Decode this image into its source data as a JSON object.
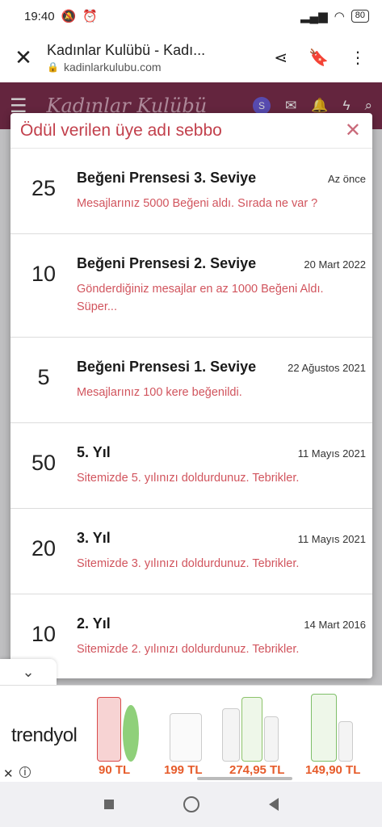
{
  "status_bar": {
    "time": "19:40",
    "battery": "80",
    "icons": [
      "mute-icon",
      "alarm-icon",
      "signal-icon",
      "wifi-icon"
    ]
  },
  "browser": {
    "title": "Kadınlar Kulübü - Kadı...",
    "url": "kadinlarkulubu.com",
    "icons": [
      "close-icon",
      "lock-icon",
      "share-icon",
      "bookmark-icon",
      "more-icon"
    ]
  },
  "site_header": {
    "logo": "Kadınlar Kulübü",
    "avatar_letter": "S"
  },
  "modal": {
    "title": "Ödül verilen üye adı sebbo",
    "awards": [
      {
        "points": "25",
        "name": "Beğeni Prensesi 3. Seviye",
        "date": "Az önce",
        "desc": "Mesajlarınız 5000 Beğeni aldı. Sırada ne var ?"
      },
      {
        "points": "10",
        "name": "Beğeni Prensesi 2. Seviye",
        "date": "20 Mart 2022",
        "desc": "Gönderdiğiniz mesajlar en az 1000 Beğeni Aldı. Süper..."
      },
      {
        "points": "5",
        "name": "Beğeni Prensesi 1. Seviye",
        "date": "22 Ağustos 2021",
        "desc": "Mesajlarınız 100 kere beğenildi."
      },
      {
        "points": "50",
        "name": "5. Yıl",
        "date": "11 Mayıs 2021",
        "desc": "Sitemizde 5. yılınızı doldurdunuz. Tebrikler."
      },
      {
        "points": "20",
        "name": "3. Yıl",
        "date": "11 Mayıs 2021",
        "desc": "Sitemizde 3. yılınızı doldurdunuz. Tebrikler."
      },
      {
        "points": "10",
        "name": "2. Yıl",
        "date": "14 Mart 2016",
        "desc": "Sitemizde 2. yılınızı doldurdunuz. Tebrikler."
      }
    ]
  },
  "ad": {
    "brand": "trendyol",
    "products": [
      {
        "price": "90 TL",
        "color": "#d94b4b"
      },
      {
        "price": "199 TL",
        "color": "#e7e7e7"
      },
      {
        "price": "274,95 TL",
        "color": "#8dc36b"
      },
      {
        "price": "149,90 TL",
        "color": "#7fbf6a"
      }
    ]
  }
}
